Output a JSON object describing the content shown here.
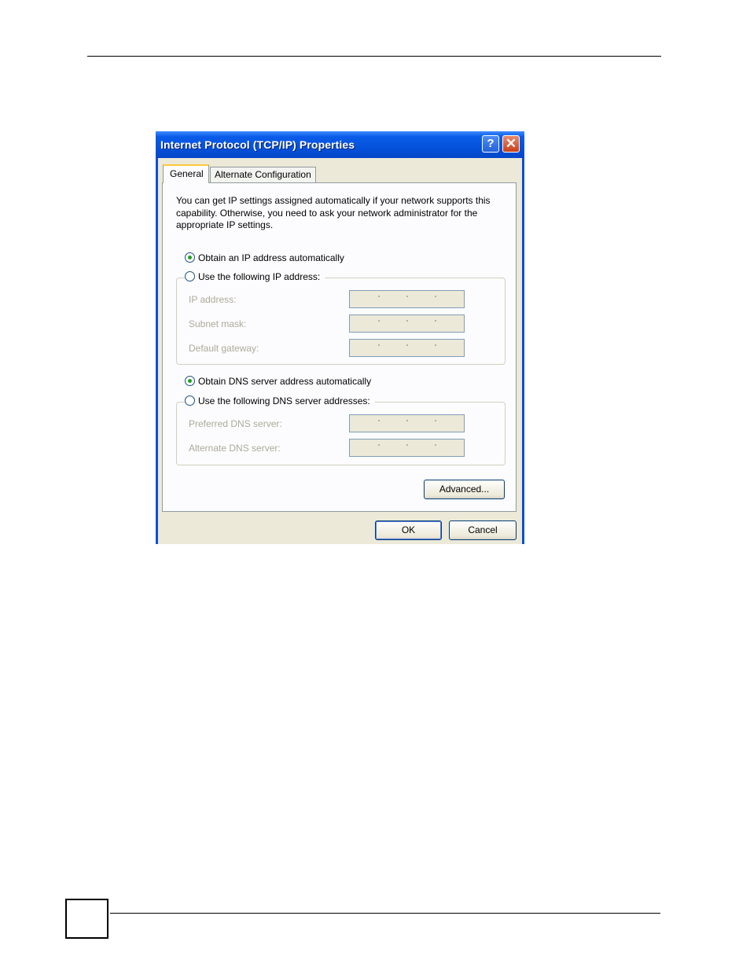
{
  "dialog": {
    "title": "Internet Protocol (TCP/IP) Properties",
    "help_symbol": "?",
    "close_symbol": "✕",
    "tabs": [
      {
        "label": "General",
        "selected": true
      },
      {
        "label": "Alternate Configuration",
        "selected": false
      }
    ],
    "intro_text": "You can get IP settings assigned automatically if your network supports this capability. Otherwise, you need to ask your network administrator for the appropriate IP settings.",
    "ip_mode": {
      "auto_label": "Obtain an IP address automatically",
      "manual_label": "Use the following IP address:",
      "selected": "auto"
    },
    "ip_fields": [
      {
        "label": "IP address:",
        "value": ". . ."
      },
      {
        "label": "Subnet mask:",
        "value": ". . ."
      },
      {
        "label": "Default gateway:",
        "value": ". . ."
      }
    ],
    "dns_mode": {
      "auto_label": "Obtain DNS server address automatically",
      "manual_label": "Use the following DNS server addresses:",
      "selected": "auto"
    },
    "dns_fields": [
      {
        "label": "Preferred DNS server:",
        "value": ". . ."
      },
      {
        "label": "Alternate DNS server:",
        "value": ". . ."
      }
    ],
    "advanced_label": "Advanced...",
    "ok_label": "OK",
    "cancel_label": "Cancel"
  }
}
